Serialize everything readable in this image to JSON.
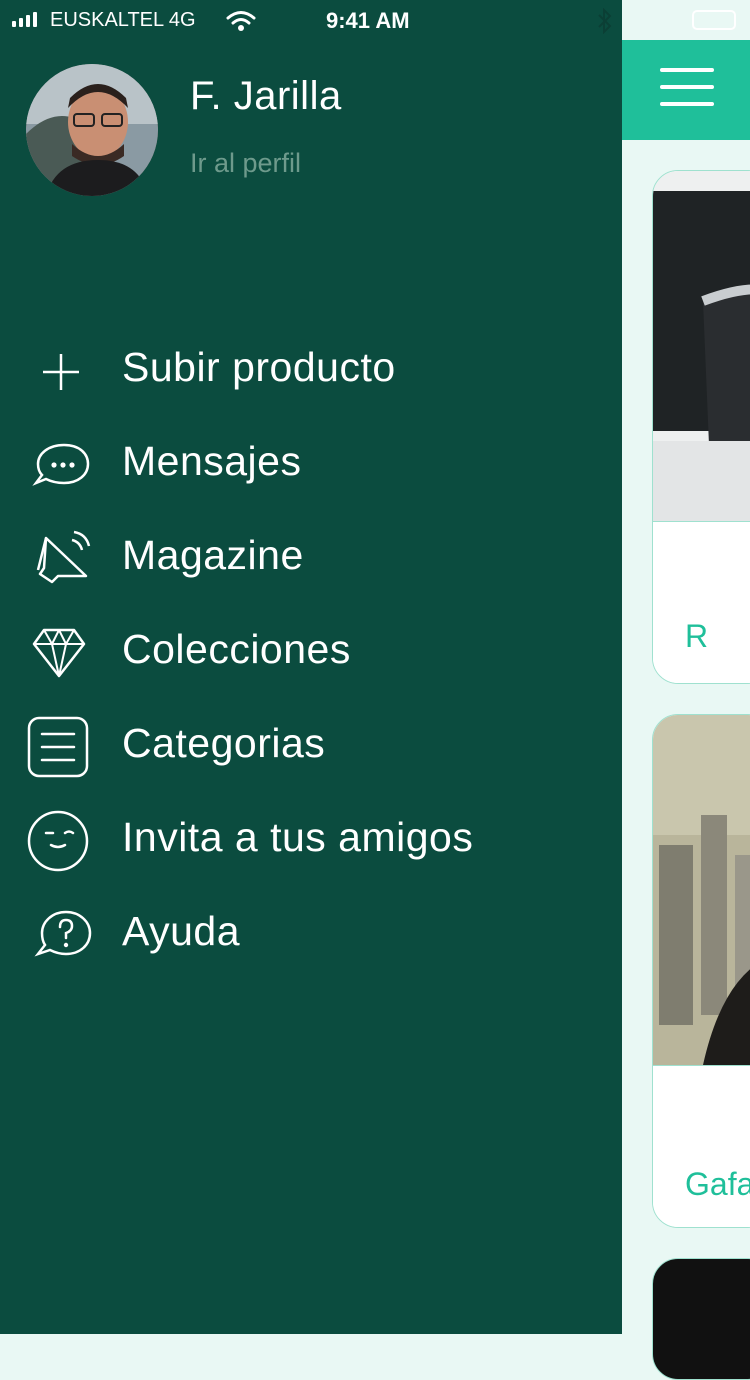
{
  "status_bar": {
    "carrier": "EUSKALTEL 4G",
    "time": "9:41 AM"
  },
  "profile": {
    "name": "F. Jarilla",
    "link": "Ir al perfil"
  },
  "menu": [
    {
      "label": "Subir producto",
      "icon": "plus-icon"
    },
    {
      "label": "Mensajes",
      "icon": "chat-bubble-icon"
    },
    {
      "label": "Magazine",
      "icon": "megaphone-icon"
    },
    {
      "label": "Colecciones",
      "icon": "diamond-icon"
    },
    {
      "label": "Categorias",
      "icon": "list-icon"
    },
    {
      "label": "Invita a tus amigos",
      "icon": "wink-face-icon"
    },
    {
      "label": "Ayuda",
      "icon": "help-bubble-icon"
    }
  ],
  "background": {
    "cards": [
      {
        "title": "R"
      },
      {
        "title": "Gafa"
      }
    ]
  },
  "colors": {
    "drawer": "#0b4c3f",
    "accent": "#1fbf9a",
    "muted": "#6e9a8c",
    "content_bg": "#e9f8f4"
  }
}
